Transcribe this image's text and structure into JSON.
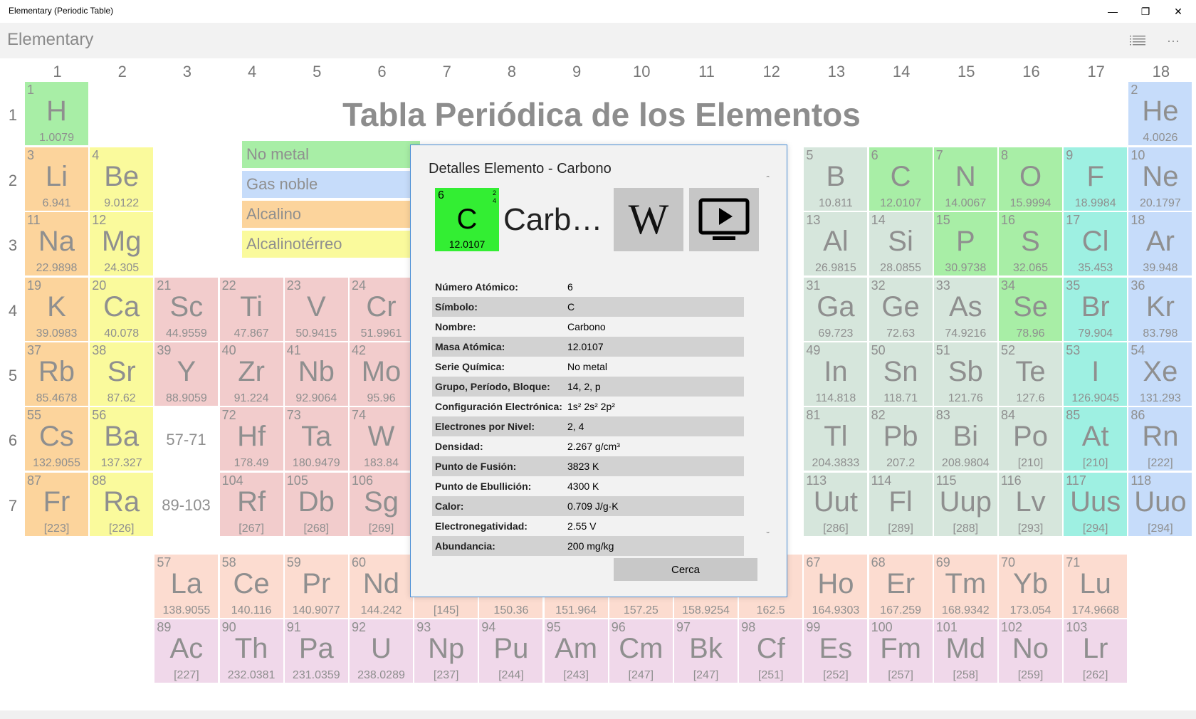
{
  "window": {
    "title": "Elementary (Periodic Table)",
    "minimize_icon": "minimize-icon",
    "restore_icon": "restore-icon",
    "close_icon": "close-icon"
  },
  "appbar": {
    "app_name": "Elementary",
    "list_icon": "list-icon",
    "more_label": "···"
  },
  "table_title": "Tabla Periódica de los Elementos",
  "columns": [
    "1",
    "2",
    "3",
    "4",
    "5",
    "6",
    "7",
    "8",
    "9",
    "10",
    "11",
    "12",
    "13",
    "14",
    "15",
    "16",
    "17",
    "18"
  ],
  "rows": [
    "1",
    "2",
    "3",
    "4",
    "5",
    "6",
    "7"
  ],
  "range_labels": {
    "lanthanides": "57-71",
    "actinides": "89-103"
  },
  "legend": [
    {
      "label": "No metal",
      "color": "#a8eea6"
    },
    {
      "label": "Gas noble",
      "color": "#c6dcfa"
    },
    {
      "label": "Alcalino",
      "color": "#fcd49c"
    },
    {
      "label": "Alcalinotérreo",
      "color": "#fafa9c"
    }
  ],
  "category_colors": {
    "nonmetal": "#a8eea6",
    "noble": "#c6dcfa",
    "alkali": "#fcd49c",
    "alkaline": "#fafa9c",
    "transition": "#f2cccc",
    "metalloid": "#d6e6dc",
    "poor": "#d6e6dc",
    "halogen": "#9ef0e2",
    "lanthanide": "#fcdcd0",
    "actinide": "#f0d8ea",
    "unknown": "#d6e6dc"
  },
  "elements": [
    {
      "n": "1",
      "s": "H",
      "m": "1.0079",
      "c": "nonmetal",
      "col": 1,
      "row": 1
    },
    {
      "n": "2",
      "s": "He",
      "m": "4.0026",
      "c": "noble",
      "col": 18,
      "row": 1
    },
    {
      "n": "3",
      "s": "Li",
      "m": "6.941",
      "c": "alkali",
      "col": 1,
      "row": 2
    },
    {
      "n": "4",
      "s": "Be",
      "m": "9.0122",
      "c": "alkaline",
      "col": 2,
      "row": 2
    },
    {
      "n": "5",
      "s": "B",
      "m": "10.811",
      "c": "metalloid",
      "col": 13,
      "row": 2
    },
    {
      "n": "6",
      "s": "C",
      "m": "12.0107",
      "c": "nonmetal",
      "col": 14,
      "row": 2
    },
    {
      "n": "7",
      "s": "N",
      "m": "14.0067",
      "c": "nonmetal",
      "col": 15,
      "row": 2
    },
    {
      "n": "8",
      "s": "O",
      "m": "15.9994",
      "c": "nonmetal",
      "col": 16,
      "row": 2
    },
    {
      "n": "9",
      "s": "F",
      "m": "18.9984",
      "c": "halogen",
      "col": 17,
      "row": 2
    },
    {
      "n": "10",
      "s": "Ne",
      "m": "20.1797",
      "c": "noble",
      "col": 18,
      "row": 2
    },
    {
      "n": "11",
      "s": "Na",
      "m": "22.9898",
      "c": "alkali",
      "col": 1,
      "row": 3
    },
    {
      "n": "12",
      "s": "Mg",
      "m": "24.305",
      "c": "alkaline",
      "col": 2,
      "row": 3
    },
    {
      "n": "13",
      "s": "Al",
      "m": "26.9815",
      "c": "poor",
      "col": 13,
      "row": 3
    },
    {
      "n": "14",
      "s": "Si",
      "m": "28.0855",
      "c": "metalloid",
      "col": 14,
      "row": 3
    },
    {
      "n": "15",
      "s": "P",
      "m": "30.9738",
      "c": "nonmetal",
      "col": 15,
      "row": 3
    },
    {
      "n": "16",
      "s": "S",
      "m": "32.065",
      "c": "nonmetal",
      "col": 16,
      "row": 3
    },
    {
      "n": "17",
      "s": "Cl",
      "m": "35.453",
      "c": "halogen",
      "col": 17,
      "row": 3
    },
    {
      "n": "18",
      "s": "Ar",
      "m": "39.948",
      "c": "noble",
      "col": 18,
      "row": 3
    },
    {
      "n": "19",
      "s": "K",
      "m": "39.0983",
      "c": "alkali",
      "col": 1,
      "row": 4
    },
    {
      "n": "20",
      "s": "Ca",
      "m": "40.078",
      "c": "alkaline",
      "col": 2,
      "row": 4
    },
    {
      "n": "21",
      "s": "Sc",
      "m": "44.9559",
      "c": "transition",
      "col": 3,
      "row": 4
    },
    {
      "n": "22",
      "s": "Ti",
      "m": "47.867",
      "c": "transition",
      "col": 4,
      "row": 4
    },
    {
      "n": "23",
      "s": "V",
      "m": "50.9415",
      "c": "transition",
      "col": 5,
      "row": 4
    },
    {
      "n": "24",
      "s": "Cr",
      "m": "51.9961",
      "c": "transition",
      "col": 6,
      "row": 4
    },
    {
      "n": "31",
      "s": "Ga",
      "m": "69.723",
      "c": "poor",
      "col": 13,
      "row": 4
    },
    {
      "n": "32",
      "s": "Ge",
      "m": "72.63",
      "c": "metalloid",
      "col": 14,
      "row": 4
    },
    {
      "n": "33",
      "s": "As",
      "m": "74.9216",
      "c": "metalloid",
      "col": 15,
      "row": 4
    },
    {
      "n": "34",
      "s": "Se",
      "m": "78.96",
      "c": "nonmetal",
      "col": 16,
      "row": 4
    },
    {
      "n": "35",
      "s": "Br",
      "m": "79.904",
      "c": "halogen",
      "col": 17,
      "row": 4
    },
    {
      "n": "36",
      "s": "Kr",
      "m": "83.798",
      "c": "noble",
      "col": 18,
      "row": 4
    },
    {
      "n": "37",
      "s": "Rb",
      "m": "85.4678",
      "c": "alkali",
      "col": 1,
      "row": 5
    },
    {
      "n": "38",
      "s": "Sr",
      "m": "87.62",
      "c": "alkaline",
      "col": 2,
      "row": 5
    },
    {
      "n": "39",
      "s": "Y",
      "m": "88.9059",
      "c": "transition",
      "col": 3,
      "row": 5
    },
    {
      "n": "40",
      "s": "Zr",
      "m": "91.224",
      "c": "transition",
      "col": 4,
      "row": 5
    },
    {
      "n": "41",
      "s": "Nb",
      "m": "92.9064",
      "c": "transition",
      "col": 5,
      "row": 5
    },
    {
      "n": "42",
      "s": "Mo",
      "m": "95.96",
      "c": "transition",
      "col": 6,
      "row": 5
    },
    {
      "n": "49",
      "s": "In",
      "m": "114.818",
      "c": "poor",
      "col": 13,
      "row": 5
    },
    {
      "n": "50",
      "s": "Sn",
      "m": "118.71",
      "c": "poor",
      "col": 14,
      "row": 5
    },
    {
      "n": "51",
      "s": "Sb",
      "m": "121.76",
      "c": "metalloid",
      "col": 15,
      "row": 5
    },
    {
      "n": "52",
      "s": "Te",
      "m": "127.6",
      "c": "metalloid",
      "col": 16,
      "row": 5
    },
    {
      "n": "53",
      "s": "I",
      "m": "126.9045",
      "c": "halogen",
      "col": 17,
      "row": 5
    },
    {
      "n": "54",
      "s": "Xe",
      "m": "131.293",
      "c": "noble",
      "col": 18,
      "row": 5
    },
    {
      "n": "55",
      "s": "Cs",
      "m": "132.9055",
      "c": "alkali",
      "col": 1,
      "row": 6
    },
    {
      "n": "56",
      "s": "Ba",
      "m": "137.327",
      "c": "alkaline",
      "col": 2,
      "row": 6
    },
    {
      "n": "72",
      "s": "Hf",
      "m": "178.49",
      "c": "transition",
      "col": 4,
      "row": 6
    },
    {
      "n": "73",
      "s": "Ta",
      "m": "180.9479",
      "c": "transition",
      "col": 5,
      "row": 6
    },
    {
      "n": "74",
      "s": "W",
      "m": "183.84",
      "c": "transition",
      "col": 6,
      "row": 6
    },
    {
      "n": "81",
      "s": "Tl",
      "m": "204.3833",
      "c": "poor",
      "col": 13,
      "row": 6
    },
    {
      "n": "82",
      "s": "Pb",
      "m": "207.2",
      "c": "poor",
      "col": 14,
      "row": 6
    },
    {
      "n": "83",
      "s": "Bi",
      "m": "208.9804",
      "c": "poor",
      "col": 15,
      "row": 6
    },
    {
      "n": "84",
      "s": "Po",
      "m": "[210]",
      "c": "metalloid",
      "col": 16,
      "row": 6
    },
    {
      "n": "85",
      "s": "At",
      "m": "[210]",
      "c": "halogen",
      "col": 17,
      "row": 6
    },
    {
      "n": "86",
      "s": "Rn",
      "m": "[222]",
      "c": "noble",
      "col": 18,
      "row": 6
    },
    {
      "n": "87",
      "s": "Fr",
      "m": "[223]",
      "c": "alkali",
      "col": 1,
      "row": 7
    },
    {
      "n": "88",
      "s": "Ra",
      "m": "[226]",
      "c": "alkaline",
      "col": 2,
      "row": 7
    },
    {
      "n": "104",
      "s": "Rf",
      "m": "[267]",
      "c": "transition",
      "col": 4,
      "row": 7
    },
    {
      "n": "105",
      "s": "Db",
      "m": "[268]",
      "c": "transition",
      "col": 5,
      "row": 7
    },
    {
      "n": "106",
      "s": "Sg",
      "m": "[269]",
      "c": "transition",
      "col": 6,
      "row": 7
    },
    {
      "n": "113",
      "s": "Uut",
      "m": "[286]",
      "c": "unknown",
      "col": 13,
      "row": 7
    },
    {
      "n": "114",
      "s": "Fl",
      "m": "[289]",
      "c": "unknown",
      "col": 14,
      "row": 7
    },
    {
      "n": "115",
      "s": "Uup",
      "m": "[288]",
      "c": "unknown",
      "col": 15,
      "row": 7
    },
    {
      "n": "116",
      "s": "Lv",
      "m": "[293]",
      "c": "unknown",
      "col": 16,
      "row": 7
    },
    {
      "n": "117",
      "s": "Uus",
      "m": "[294]",
      "c": "halogen",
      "col": 17,
      "row": 7
    },
    {
      "n": "118",
      "s": "Uuo",
      "m": "[294]",
      "c": "noble",
      "col": 18,
      "row": 7
    },
    {
      "n": "57",
      "s": "La",
      "m": "138.9055",
      "c": "lanthanide",
      "col": 3,
      "row": 8
    },
    {
      "n": "58",
      "s": "Ce",
      "m": "140.116",
      "c": "lanthanide",
      "col": 4,
      "row": 8
    },
    {
      "n": "59",
      "s": "Pr",
      "m": "140.9077",
      "c": "lanthanide",
      "col": 5,
      "row": 8
    },
    {
      "n": "60",
      "s": "Nd",
      "m": "144.242",
      "c": "lanthanide",
      "col": 6,
      "row": 8
    },
    {
      "n": "",
      "s": "",
      "m": "[145]",
      "c": "lanthanide",
      "col": 7,
      "row": 8
    },
    {
      "n": "",
      "s": "",
      "m": "150.36",
      "c": "lanthanide",
      "col": 8,
      "row": 8
    },
    {
      "n": "",
      "s": "",
      "m": "151.964",
      "c": "lanthanide",
      "col": 9,
      "row": 8
    },
    {
      "n": "",
      "s": "",
      "m": "157.25",
      "c": "lanthanide",
      "col": 10,
      "row": 8
    },
    {
      "n": "",
      "s": "",
      "m": "158.9254",
      "c": "lanthanide",
      "col": 11,
      "row": 8
    },
    {
      "n": "",
      "s": "",
      "m": "162.5",
      "c": "lanthanide",
      "col": 12,
      "row": 8
    },
    {
      "n": "67",
      "s": "Ho",
      "m": "164.9303",
      "c": "lanthanide",
      "col": 13,
      "row": 8
    },
    {
      "n": "68",
      "s": "Er",
      "m": "167.259",
      "c": "lanthanide",
      "col": 14,
      "row": 8
    },
    {
      "n": "69",
      "s": "Tm",
      "m": "168.9342",
      "c": "lanthanide",
      "col": 15,
      "row": 8
    },
    {
      "n": "70",
      "s": "Yb",
      "m": "173.054",
      "c": "lanthanide",
      "col": 16,
      "row": 8
    },
    {
      "n": "71",
      "s": "Lu",
      "m": "174.9668",
      "c": "lanthanide",
      "col": 17,
      "row": 8
    },
    {
      "n": "89",
      "s": "Ac",
      "m": "[227]",
      "c": "actinide",
      "col": 3,
      "row": 9
    },
    {
      "n": "90",
      "s": "Th",
      "m": "232.0381",
      "c": "actinide",
      "col": 4,
      "row": 9
    },
    {
      "n": "91",
      "s": "Pa",
      "m": "231.0359",
      "c": "actinide",
      "col": 5,
      "row": 9
    },
    {
      "n": "92",
      "s": "U",
      "m": "238.0289",
      "c": "actinide",
      "col": 6,
      "row": 9
    },
    {
      "n": "93",
      "s": "Np",
      "m": "[237]",
      "c": "actinide",
      "col": 7,
      "row": 9
    },
    {
      "n": "94",
      "s": "Pu",
      "m": "[244]",
      "c": "actinide",
      "col": 8,
      "row": 9
    },
    {
      "n": "95",
      "s": "Am",
      "m": "[243]",
      "c": "actinide",
      "col": 9,
      "row": 9
    },
    {
      "n": "96",
      "s": "Cm",
      "m": "[247]",
      "c": "actinide",
      "col": 10,
      "row": 9
    },
    {
      "n": "97",
      "s": "Bk",
      "m": "[247]",
      "c": "actinide",
      "col": 11,
      "row": 9
    },
    {
      "n": "98",
      "s": "Cf",
      "m": "[251]",
      "c": "actinide",
      "col": 12,
      "row": 9
    },
    {
      "n": "99",
      "s": "Es",
      "m": "[252]",
      "c": "actinide",
      "col": 13,
      "row": 9
    },
    {
      "n": "100",
      "s": "Fm",
      "m": "[257]",
      "c": "actinide",
      "col": 14,
      "row": 9
    },
    {
      "n": "101",
      "s": "Md",
      "m": "[258]",
      "c": "actinide",
      "col": 15,
      "row": 9
    },
    {
      "n": "102",
      "s": "No",
      "m": "[259]",
      "c": "actinide",
      "col": 16,
      "row": 9
    },
    {
      "n": "103",
      "s": "Lr",
      "m": "[262]",
      "c": "actinide",
      "col": 17,
      "row": 9
    }
  ],
  "dialog": {
    "title": "Detalles Elemento - Carbono",
    "element": {
      "number": "6",
      "symbol": "C",
      "mass": "12.0107",
      "shells": [
        "2",
        "4"
      ],
      "name": "Carbono",
      "color": "#33ee33"
    },
    "wikipedia_label": "W",
    "video_icon": "video-play-icon",
    "properties": [
      {
        "label": "Número Atómico:",
        "value": "6"
      },
      {
        "label": "Símbolo:",
        "value": "C"
      },
      {
        "label": "Nombre:",
        "value": "Carbono"
      },
      {
        "label": "Masa Atómica:",
        "value": "12.0107"
      },
      {
        "label": "Serie Química:",
        "value": "No metal"
      },
      {
        "label": "Grupo, Período, Bloque:",
        "value": "14, 2, p"
      },
      {
        "label": "Configuración Electrónica:",
        "value": "1s² 2s² 2p²"
      },
      {
        "label": "Electrones por Nivel:",
        "value": "2, 4"
      },
      {
        "label": "Densidad:",
        "value": "2.267 g/cm³"
      },
      {
        "label": "Punto de Fusión:",
        "value": "3823 K"
      },
      {
        "label": "Punto de Ebullición:",
        "value": "4300 K"
      },
      {
        "label": "Calor:",
        "value": "0.709 J/g·K"
      },
      {
        "label": "Electronegatividad:",
        "value": "2.55 V"
      },
      {
        "label": "Abundancia:",
        "value": "200 mg/kg"
      }
    ],
    "close_label": "Cerca"
  }
}
